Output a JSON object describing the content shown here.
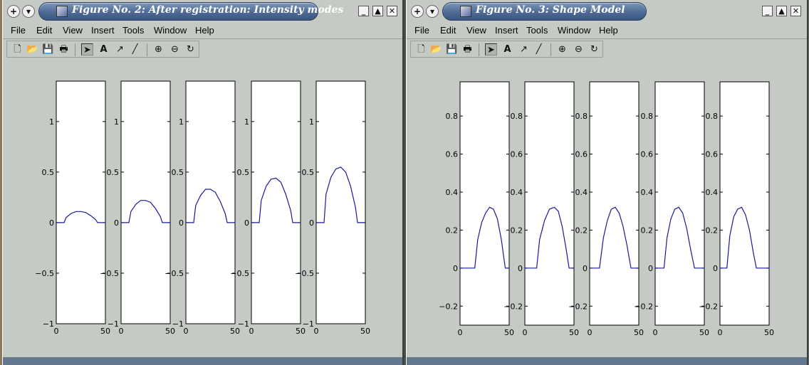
{
  "windows": [
    {
      "title": "Figure No. 2: After registration: Intensity modes",
      "menu": [
        "File",
        "Edit",
        "View",
        "Insert",
        "Tools",
        "Window",
        "Help"
      ],
      "plot": {
        "xticks": [
          "0",
          "50"
        ],
        "yticks": [
          {
            "v": -1,
            "label": "−1"
          },
          {
            "v": -0.5,
            "label": "−0.5"
          },
          {
            "v": 0,
            "label": "0"
          },
          {
            "v": 0.5,
            "label": "0.5"
          },
          {
            "v": 1,
            "label": "1"
          }
        ]
      }
    },
    {
      "title": "Figure No. 3: Shape Model",
      "menu": [
        "File",
        "Edit",
        "View",
        "Insert",
        "Tools",
        "Window",
        "Help"
      ],
      "plot": {
        "xticks": [
          "0",
          "50"
        ],
        "yticks": [
          {
            "v": -0.2,
            "label": "−0.2"
          },
          {
            "v": 0,
            "label": "0"
          },
          {
            "v": 0.2,
            "label": "0.2"
          },
          {
            "v": 0.4,
            "label": "0.4"
          },
          {
            "v": 0.6,
            "label": "0.6"
          },
          {
            "v": 0.8,
            "label": "0.8"
          }
        ]
      }
    }
  ],
  "toolbar_icons": [
    "new-file-icon",
    "open-folder-icon",
    "save-icon",
    "print-icon",
    "select-arrow-icon",
    "insert-text-icon",
    "insert-arrow-icon",
    "insert-line-icon",
    "zoom-in-icon",
    "zoom-out-icon",
    "rotate-icon"
  ],
  "chart_data": [
    {
      "type": "line",
      "panels": 5,
      "xlim": [
        0,
        50
      ],
      "ylim": [
        -1,
        1.4
      ],
      "xlabel": "",
      "ylabel": "",
      "series": [
        {
          "x": [
            0,
            8,
            10,
            15,
            20,
            25,
            30,
            35,
            40,
            42,
            50
          ],
          "y": [
            0,
            0,
            0.05,
            0.09,
            0.11,
            0.11,
            0.1,
            0.07,
            0.03,
            0,
            0
          ]
        },
        {
          "x": [
            0,
            8,
            10,
            15,
            20,
            25,
            30,
            35,
            40,
            42,
            50
          ],
          "y": [
            0,
            0,
            0.11,
            0.18,
            0.22,
            0.22,
            0.2,
            0.14,
            0.06,
            0,
            0
          ]
        },
        {
          "x": [
            0,
            8,
            10,
            15,
            20,
            25,
            30,
            35,
            40,
            42,
            50
          ],
          "y": [
            0,
            0,
            0.17,
            0.27,
            0.33,
            0.33,
            0.3,
            0.21,
            0.09,
            0,
            0
          ]
        },
        {
          "x": [
            0,
            8,
            10,
            15,
            20,
            25,
            30,
            35,
            40,
            42,
            50
          ],
          "y": [
            0,
            0,
            0.22,
            0.36,
            0.43,
            0.44,
            0.4,
            0.28,
            0.12,
            0,
            0
          ]
        },
        {
          "x": [
            0,
            8,
            10,
            15,
            20,
            25,
            30,
            35,
            40,
            42,
            50
          ],
          "y": [
            0,
            0,
            0.28,
            0.45,
            0.53,
            0.55,
            0.5,
            0.36,
            0.15,
            0,
            0
          ]
        }
      ]
    },
    {
      "type": "line",
      "panels": 5,
      "xlim": [
        0,
        50
      ],
      "ylim": [
        -0.3,
        0.98
      ],
      "xlabel": "",
      "ylabel": "",
      "series": [
        {
          "x": [
            0,
            10,
            15,
            18,
            22,
            26,
            30,
            34,
            38,
            42,
            46,
            48,
            50
          ],
          "y": [
            0,
            0,
            0,
            0.15,
            0.24,
            0.29,
            0.32,
            0.31,
            0.26,
            0.15,
            0,
            0,
            0
          ]
        },
        {
          "x": [
            0,
            5,
            12,
            15,
            20,
            25,
            30,
            34,
            38,
            42,
            45,
            50
          ],
          "y": [
            0,
            0,
            0,
            0.15,
            0.25,
            0.31,
            0.32,
            0.3,
            0.22,
            0.1,
            0,
            0
          ]
        },
        {
          "x": [
            0,
            5,
            10,
            14,
            18,
            22,
            26,
            30,
            34,
            38,
            42,
            50
          ],
          "y": [
            0,
            0,
            0,
            0.16,
            0.25,
            0.31,
            0.32,
            0.29,
            0.22,
            0.12,
            0,
            0
          ]
        },
        {
          "x": [
            0,
            5,
            9,
            12,
            16,
            20,
            24,
            28,
            32,
            36,
            40,
            50
          ],
          "y": [
            0,
            0,
            0,
            0.16,
            0.26,
            0.31,
            0.32,
            0.29,
            0.21,
            0.1,
            0,
            0
          ]
        },
        {
          "x": [
            0,
            5,
            7,
            10,
            14,
            18,
            22,
            26,
            30,
            34,
            37,
            50
          ],
          "y": [
            0,
            0,
            0,
            0.17,
            0.27,
            0.31,
            0.32,
            0.28,
            0.2,
            0.08,
            0,
            0
          ]
        }
      ]
    }
  ]
}
